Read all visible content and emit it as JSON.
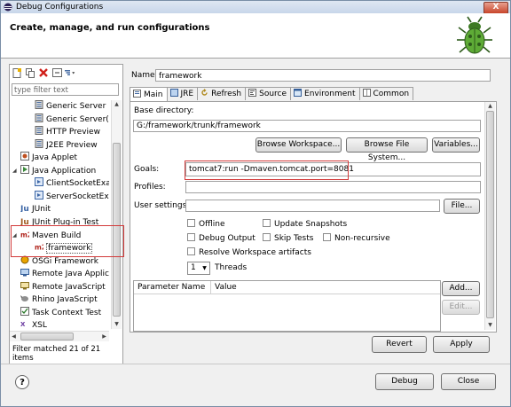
{
  "window": {
    "title": "Debug Configurations",
    "close_label": "X"
  },
  "header": {
    "title": "Create, manage, and run configurations"
  },
  "left": {
    "filter_placeholder": "type filter text",
    "tree": [
      {
        "label": "Generic Server",
        "indent": 1,
        "icon": "server-icon"
      },
      {
        "label": "Generic Server(Exter",
        "indent": 1,
        "icon": "server-icon"
      },
      {
        "label": "HTTP Preview",
        "indent": 1,
        "icon": "server-icon"
      },
      {
        "label": "J2EE Preview",
        "indent": 1,
        "icon": "server-icon"
      },
      {
        "label": "Java Applet",
        "indent": 0,
        "icon": "java-applet-icon"
      },
      {
        "label": "Java Application",
        "indent": 0,
        "icon": "java-application-icon",
        "expanded": true
      },
      {
        "label": "ClientSocketExan",
        "indent": 1,
        "icon": "java-class-icon"
      },
      {
        "label": "ServerSocketExan",
        "indent": 1,
        "icon": "java-class-icon"
      },
      {
        "label": "JUnit",
        "indent": 0,
        "icon": "junit-icon"
      },
      {
        "label": "JUnit Plug-in Test",
        "indent": 0,
        "icon": "junit-plugin-icon"
      },
      {
        "label": "Maven Build",
        "indent": 0,
        "icon": "maven-icon",
        "expanded": true
      },
      {
        "label": "framework",
        "indent": 1,
        "icon": "maven-icon",
        "selected": true
      },
      {
        "label": "OSGi Framework",
        "indent": 0,
        "icon": "osgi-icon"
      },
      {
        "label": "Remote Java Applic",
        "indent": 0,
        "icon": "remote-java-icon"
      },
      {
        "label": "Remote JavaScript",
        "indent": 0,
        "icon": "remote-javascript-icon"
      },
      {
        "label": "Rhino JavaScript",
        "indent": 0,
        "icon": "rhino-icon"
      },
      {
        "label": "Task Context Test",
        "indent": 0,
        "icon": "task-context-icon"
      },
      {
        "label": "XSL",
        "indent": 0,
        "icon": "xsl-icon"
      }
    ],
    "status": "Filter matched 21 of 21 items"
  },
  "main": {
    "name_label": "Name:",
    "name_value": "framework",
    "tabs": [
      {
        "label": "Main",
        "icon": "main-tab-icon",
        "active": true
      },
      {
        "label": "JRE",
        "icon": "jre-icon"
      },
      {
        "label": "Refresh",
        "icon": "refresh-icon"
      },
      {
        "label": "Source",
        "icon": "source-icon"
      },
      {
        "label": "Environment",
        "icon": "environment-icon"
      },
      {
        "label": "Common",
        "icon": "common-icon"
      }
    ],
    "base_dir_label": "Base directory:",
    "base_dir_value": "G:/framework/trunk/framework",
    "browse_workspace": "Browse Workspace...",
    "browse_fs": "Browse File System...",
    "variables": "Variables...",
    "goals_label": "Goals:",
    "goals_value": "tomcat7:run -Dmaven.tomcat.port=8081",
    "profiles_label": "Profiles:",
    "profiles_value": "",
    "user_settings_label": "User settings:",
    "file_button": "File...",
    "checkboxes": {
      "offline": "Offline",
      "update_snapshots": "Update Snapshots",
      "debug_output": "Debug Output",
      "skip_tests": "Skip Tests",
      "non_recursive": "Non-recursive",
      "resolve_workspace": "Resolve Workspace artifacts"
    },
    "threads_value": "1",
    "threads_label": "Threads",
    "params_columns": [
      "Parameter Name",
      "Value"
    ],
    "add_button": "Add...",
    "edit_button": "Edit...",
    "revert_button": "Revert",
    "apply_button": "Apply"
  },
  "footer": {
    "help_label": "?",
    "debug_button": "Debug",
    "close_button": "Close"
  }
}
